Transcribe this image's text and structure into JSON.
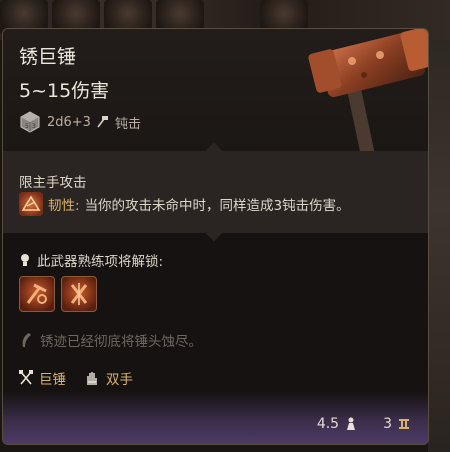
{
  "item": {
    "name": "锈巨锤",
    "damage": "5~15伤害",
    "dice": "2d6+3",
    "damage_type": "钝击"
  },
  "restriction": {
    "label": "限主手攻击",
    "perk_name": "韧性:",
    "perk_desc": "当你的攻击未命中时，同样造成3钝击伤害。"
  },
  "proficiency": {
    "label": "此武器熟练项将解锁:",
    "actions": [
      {
        "icon": "smash-action-icon"
      },
      {
        "icon": "cleave-action-icon"
      }
    ]
  },
  "flavor": "锈迹已经彻底将锤头蚀尽。",
  "tags": [
    {
      "icon": "crossed-hammers-icon",
      "label": "巨锤"
    },
    {
      "icon": "two-hands-icon",
      "label": "双手"
    }
  ],
  "stats": {
    "weight": "4.5",
    "value": "3"
  },
  "colors": {
    "accent_gold": "#d9b26a",
    "footer_purple": "#4e3b66",
    "rust": "#c85a2a"
  }
}
